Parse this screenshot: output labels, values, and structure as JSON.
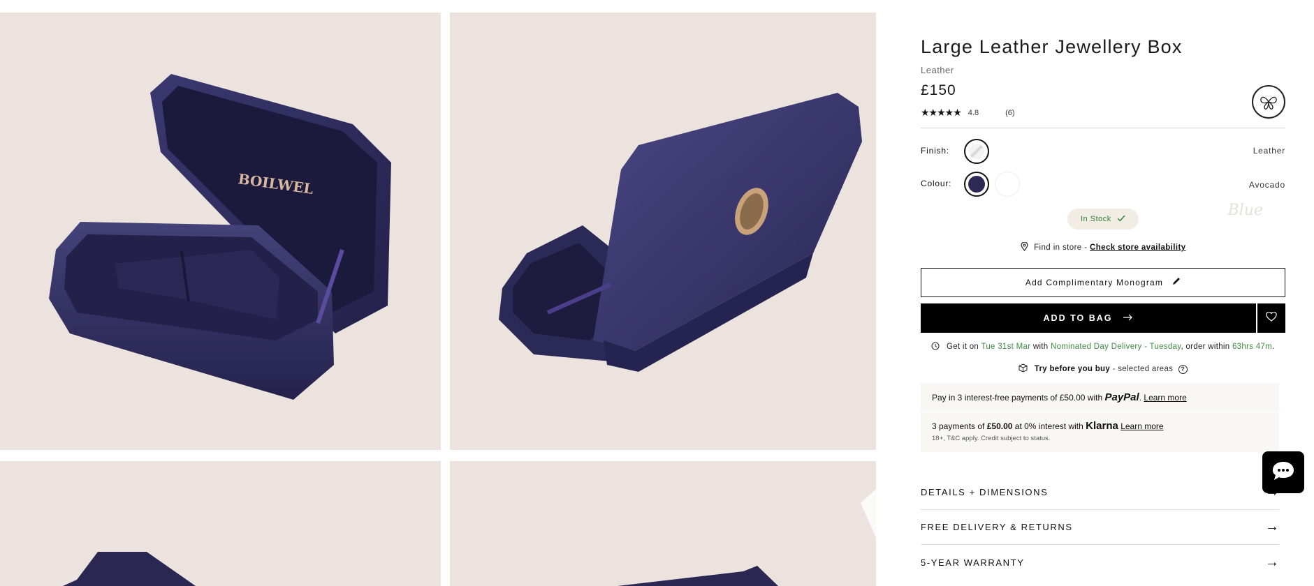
{
  "product": {
    "title": "Large Leather Jewellery Box",
    "material": "Leather",
    "price": "£150",
    "rating_stars": "★★★★★",
    "rating_value": "4.8",
    "review_count": "(6)",
    "badge_icon": "butterfly-icon"
  },
  "gallery": {
    "box_brand": "BOILWEL"
  },
  "options": {
    "finish_label": "Finish:",
    "finish_value": "Leather",
    "colour_label": "Colour:",
    "colour_value": "Avocado",
    "colour_overlay": "Blue",
    "colours": [
      "#2c2a55",
      "#ffffff"
    ]
  },
  "stock": {
    "label": "In Stock",
    "icon": "check-icon"
  },
  "store": {
    "prefix": "Find in store -",
    "link": "Check store availability"
  },
  "actions": {
    "monogram": "Add Complimentary Monogram",
    "add_to_bag": "ADD TO BAG"
  },
  "delivery": {
    "prefix": "Get it on",
    "date": "Tue 31st Mar",
    "with": "with",
    "method": "Nominated Day Delivery - Tuesday",
    "order_within": ", order within",
    "time": "63hrs 47m",
    "end": "."
  },
  "try_before": {
    "bold": "Try before you buy",
    "rest": "- selected areas"
  },
  "payments": {
    "paypal_text": "Pay in 3 interest-free payments of £50.00 with",
    "paypal_brand": "PayPal",
    "learn_more": "Learn more",
    "klarna_pre": "3 payments of",
    "klarna_amount": "£50.00",
    "klarna_post": "at 0% interest with",
    "klarna_brand": "Klarna",
    "klarna_small": "18+, T&C apply. Credit subject to status."
  },
  "accordion": [
    {
      "label": "DETAILS + DIMENSIONS"
    },
    {
      "label": "FREE DELIVERY & RETURNS"
    },
    {
      "label": "5-YEAR WARRANTY"
    }
  ],
  "colors": {
    "tile_bg": "#ece3de",
    "box_navy": "#2c2a55",
    "delivery_green": "#3f8c3f",
    "stock_green": "#2f7d32"
  }
}
